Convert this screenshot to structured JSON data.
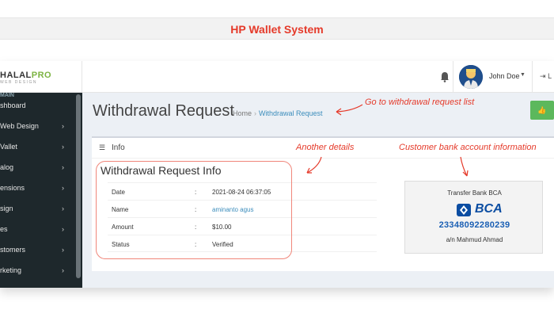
{
  "banner": {
    "title": "HP Wallet System"
  },
  "header": {
    "logo_main": "HALAL",
    "logo_accent": "PRO",
    "logo_sub": "WEB DESIGN",
    "username": "John Doe",
    "logout_label": "L"
  },
  "sidebar": {
    "top_label": "MAIN",
    "items": [
      {
        "label": "shboard",
        "chevron": false
      },
      {
        "label": "Web Design",
        "chevron": true
      },
      {
        "label": "Vallet",
        "chevron": true
      },
      {
        "label": "alog",
        "chevron": true
      },
      {
        "label": "ensions",
        "chevron": true
      },
      {
        "label": "sign",
        "chevron": true
      },
      {
        "label": "es",
        "chevron": true
      },
      {
        "label": "stomers",
        "chevron": true
      },
      {
        "label": "rketing",
        "chevron": true
      }
    ]
  },
  "page": {
    "title": "Withdrawal Request",
    "breadcrumb_home": "Home",
    "breadcrumb_active": "Withdrawal Request"
  },
  "box": {
    "header_title": "Info",
    "info_title": "Withdrawal Request Info",
    "rows": [
      {
        "key": "Date",
        "value": "2021-08-24 06:37:05",
        "link": false
      },
      {
        "key": "Name",
        "value": "aminanto agus",
        "link": true
      },
      {
        "key": "Amount",
        "value": "$10.00",
        "link": false
      },
      {
        "key": "Status",
        "value": "Verified",
        "link": false
      }
    ],
    "separator": ":"
  },
  "bank": {
    "label": "Transfer Bank BCA",
    "bank_logo": "BCA",
    "account_number": "23348092280239",
    "account_name": "a/n Mahmud Ahmad"
  },
  "annotations": {
    "go_to_list": "Go to withdrawal request list",
    "another_details": "Another details",
    "customer_bank": "Customer bank account information"
  },
  "colors": {
    "annotation": "#e53a2a",
    "sidebar_bg": "#1e282c",
    "link": "#3c8dbc",
    "success": "#5cb85c",
    "bca_blue": "#0b4da2"
  }
}
